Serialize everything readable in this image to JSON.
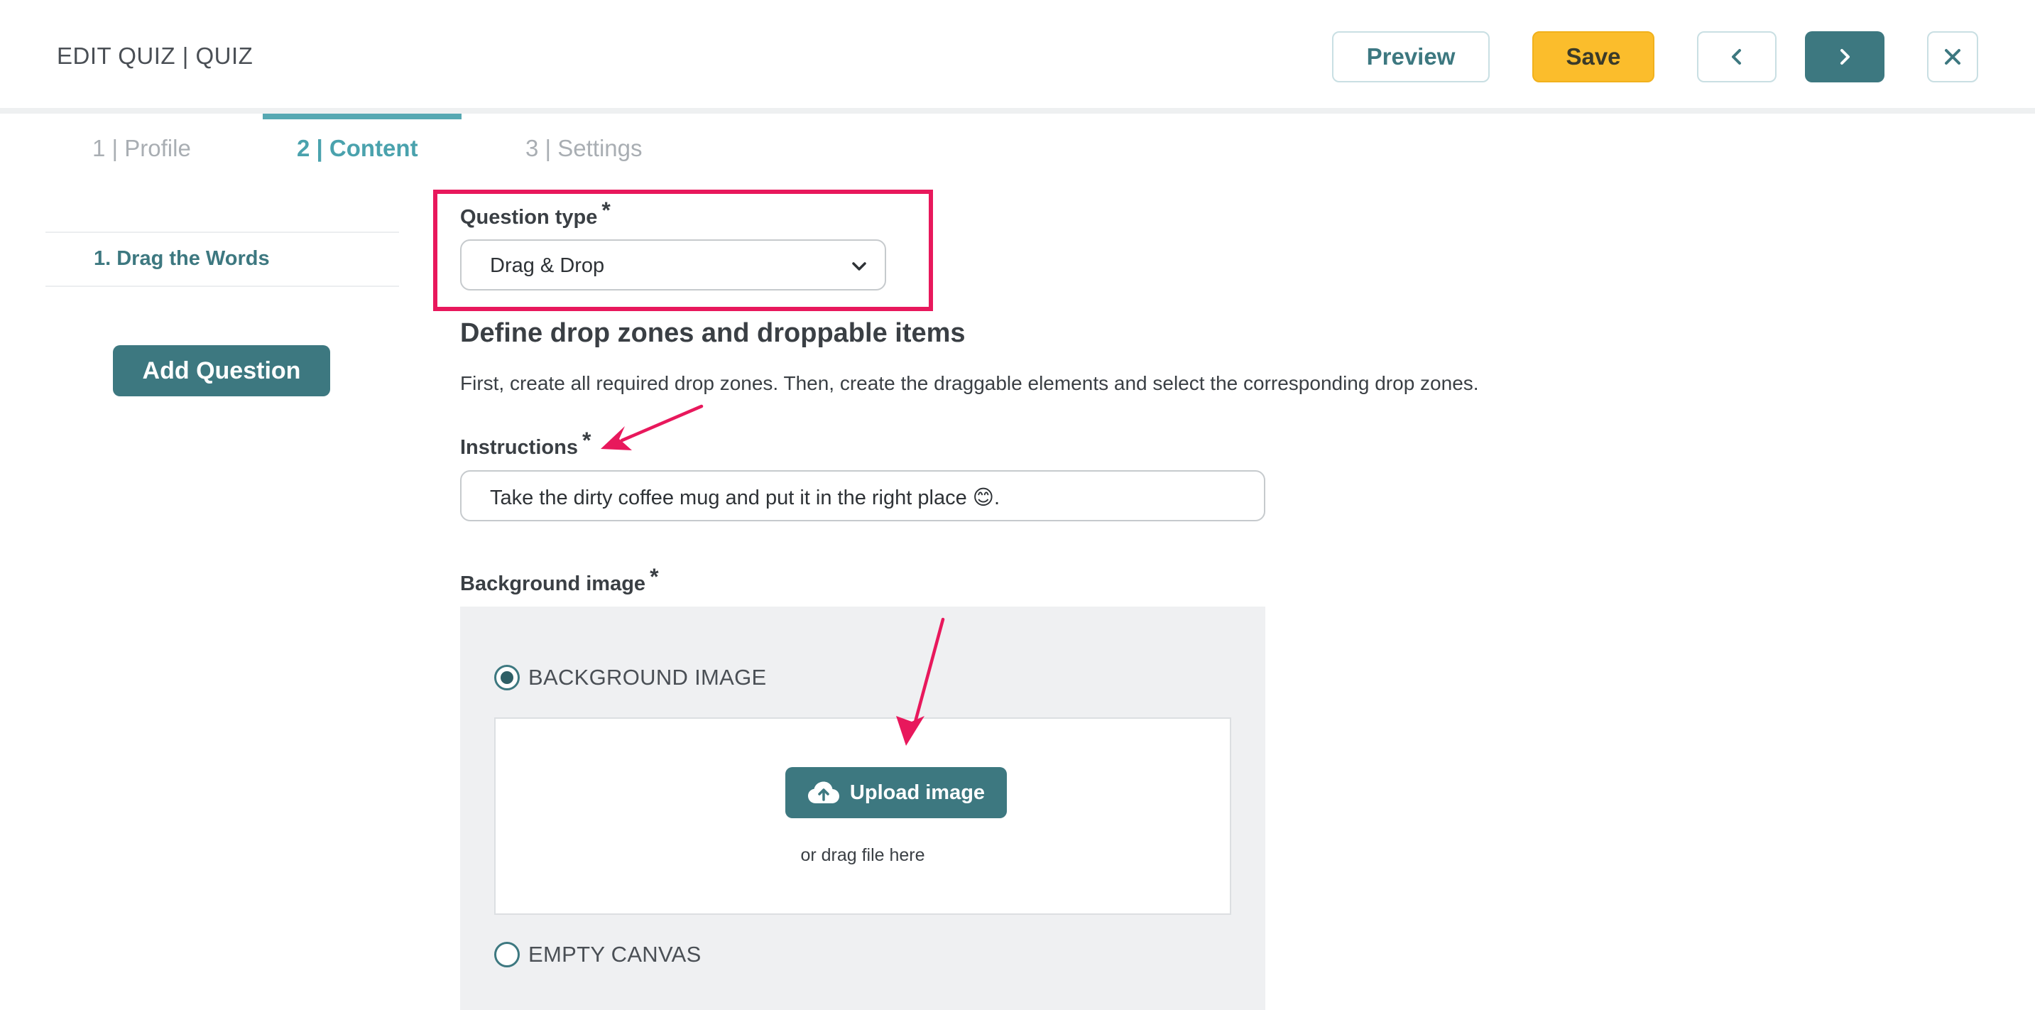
{
  "header": {
    "title": "EDIT QUIZ | QUIZ",
    "preview_label": "Preview",
    "save_label": "Save"
  },
  "tabs": [
    {
      "label": "1 | Profile",
      "active": false
    },
    {
      "label": "2 | Content",
      "active": true
    },
    {
      "label": "3 | Settings",
      "active": false
    }
  ],
  "sidebar": {
    "items": [
      {
        "label": "1. Drag the Words"
      }
    ],
    "add_question_label": "Add Question"
  },
  "form": {
    "question_type": {
      "label": "Question type",
      "required_mark": "*",
      "value": "Drag & Drop"
    },
    "section_title": "Define drop zones and droppable items",
    "section_description": "First, create all required drop zones. Then, create the draggable elements and select the corresponding drop zones.",
    "instructions": {
      "label": "Instructions",
      "required_mark": "*",
      "value": "Take the dirty coffee mug and put it in the right place 😊."
    },
    "background": {
      "label": "Background image",
      "required_mark": "*",
      "option_image": "BACKGROUND IMAGE",
      "option_image_selected": true,
      "upload_label": "Upload image",
      "drop_hint": "or drag file here",
      "option_empty": "EMPTY CANVAS"
    }
  },
  "colors": {
    "primary": "#3d7880",
    "accent_save": "#fbbd2c",
    "active_tab": "#4aa2ad",
    "annotation": "#e8185c"
  },
  "icons": [
    "chevron-left-icon",
    "chevron-right-icon",
    "close-icon",
    "chevron-down-icon",
    "cloud-upload-icon"
  ]
}
